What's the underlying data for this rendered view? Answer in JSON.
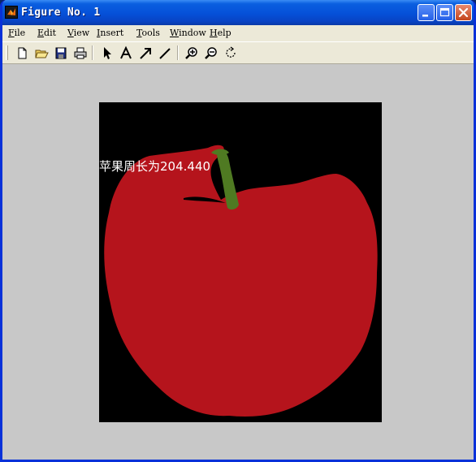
{
  "window": {
    "title": "Figure No. 1",
    "icon": "matlab-icon",
    "controls": [
      "minimize-icon",
      "maximize-icon",
      "close-icon"
    ]
  },
  "menubar": [
    {
      "mnemonic": "F",
      "rest": "ile"
    },
    {
      "mnemonic": "E",
      "rest": "dit"
    },
    {
      "mnemonic": "V",
      "rest": "iew"
    },
    {
      "mnemonic": "I",
      "rest": "nsert"
    },
    {
      "mnemonic": "T",
      "rest": "ools"
    },
    {
      "mnemonic": "W",
      "rest": "indow"
    },
    {
      "mnemonic": "H",
      "rest": "elp"
    }
  ],
  "toolbar": {
    "tools": [
      "new-file-icon",
      "open-folder-icon",
      "save-icon",
      "print-icon",
      "select-arrow-icon",
      "insert-text-icon",
      "insert-arrow-icon",
      "insert-line-icon",
      "zoom-in-icon",
      "zoom-out-icon",
      "rotate-3d-icon"
    ]
  },
  "figure": {
    "annotation": "苹果周长为204.440",
    "colors": {
      "background": "#c8c8c8",
      "axes": "#000000",
      "apple": "#b5141c",
      "stem": "#4f7a22",
      "text": "#ffffff"
    }
  }
}
